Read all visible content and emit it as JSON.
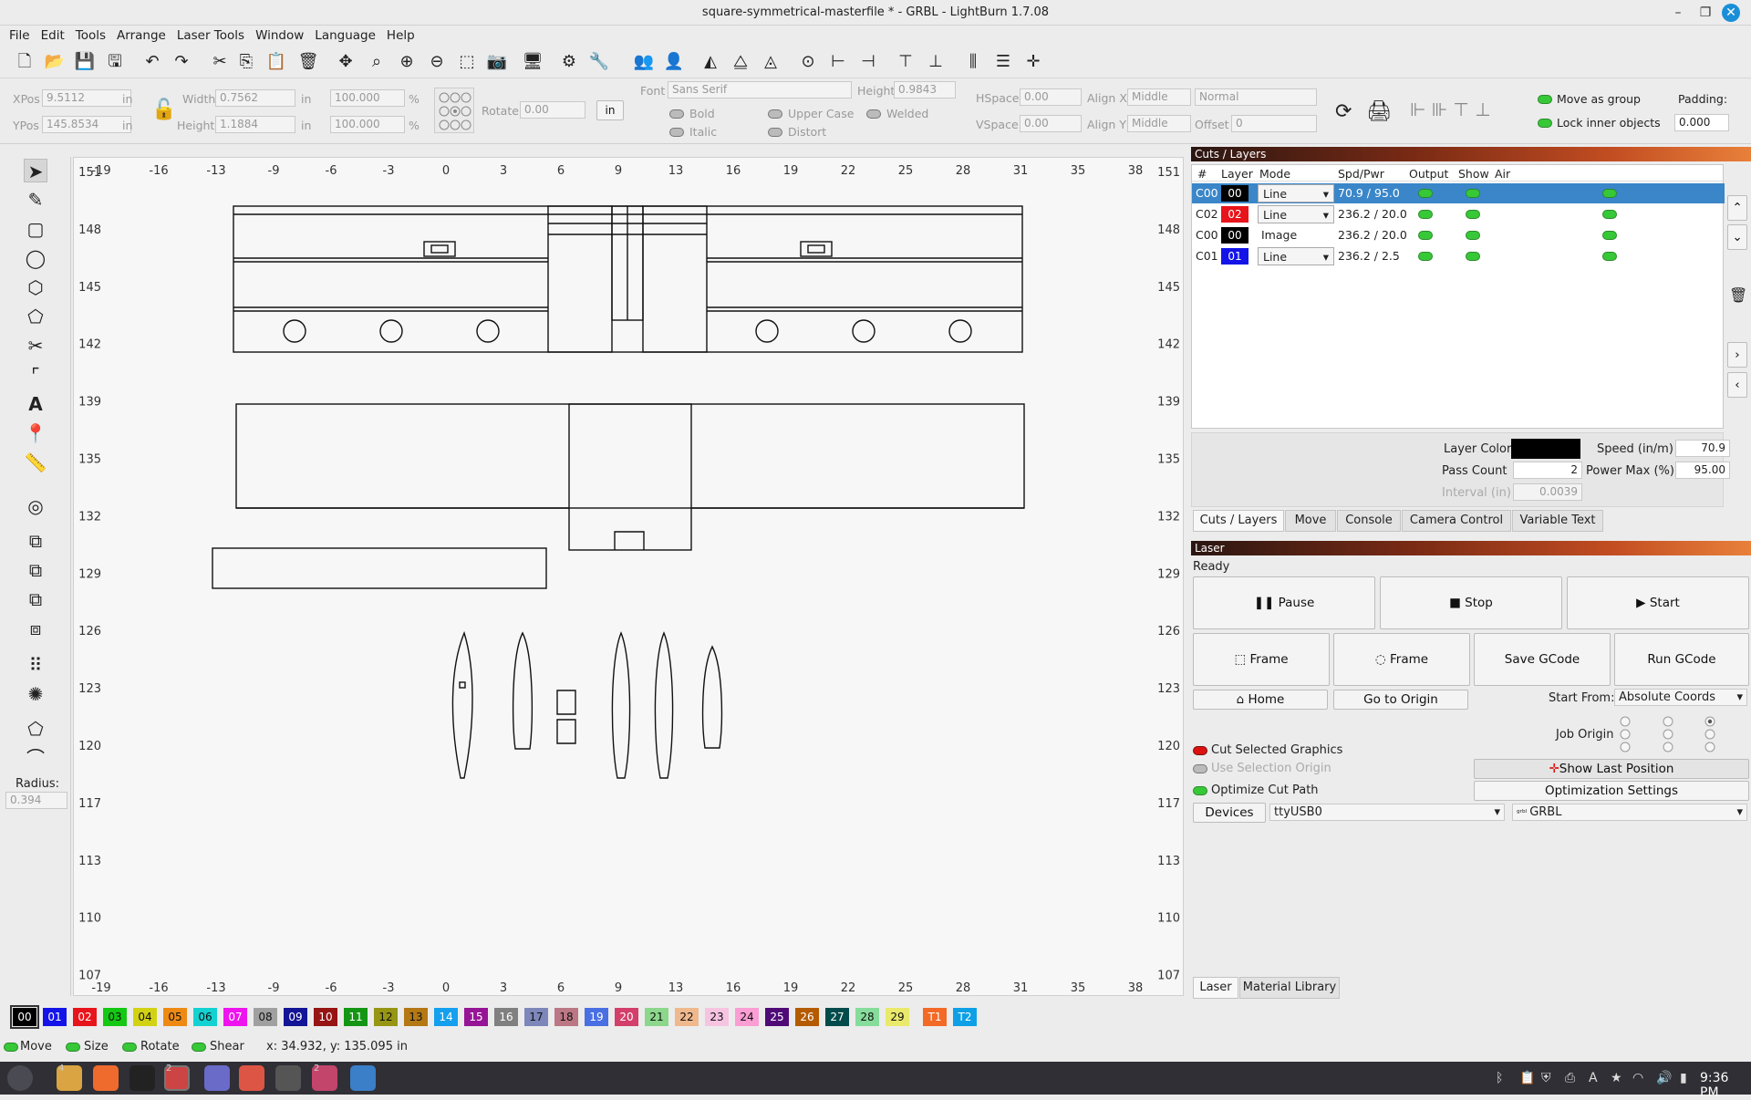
{
  "window": {
    "title": "square-symmetrical-masterfile * - GRBL - LightBurn 1.7.08"
  },
  "menu": [
    "File",
    "Edit",
    "Tools",
    "Arrange",
    "Laser Tools",
    "Window",
    "Language",
    "Help"
  ],
  "props": {
    "xpos_label": "XPos",
    "xpos": "9.5112",
    "ypos_label": "YPos",
    "ypos": "145.8534",
    "unit": "in",
    "width_label": "Width",
    "width": "0.7562",
    "height_label": "Height",
    "height": "1.1884",
    "scale_w": "100.000",
    "scale_h": "100.000",
    "percent": "%",
    "rotate_label": "Rotate",
    "rotate": "0.00",
    "in_btn": "in",
    "font_label": "Font",
    "font": "Sans Serif",
    "fheight_label": "Height",
    "fheight": "0.9843",
    "hspace_label": "HSpace",
    "hspace": "0.00",
    "vspace_label": "VSpace",
    "vspace": "0.00",
    "alignx_label": "Align X",
    "alignx": "Middle",
    "aligny_label": "Align Y",
    "aligny": "Middle",
    "normal": "Normal",
    "offset_label": "Offset",
    "offset": "0",
    "bold": "Bold",
    "italic": "Italic",
    "upper": "Upper Case",
    "distort": "Distort",
    "welded": "Welded",
    "move_group": "Move as group",
    "lock_inner": "Lock inner objects",
    "padding_label": "Padding:",
    "padding": "0.000"
  },
  "left_radius": {
    "label": "Radius:",
    "value": "0.394"
  },
  "axes": {
    "x": [
      "-19",
      "-16",
      "-13",
      "-9",
      "-6",
      "-3",
      "0",
      "3",
      "6",
      "9",
      "13",
      "16",
      "19",
      "22",
      "25",
      "28",
      "31",
      "35",
      "38"
    ],
    "y": [
      "151",
      "148",
      "145",
      "142",
      "139",
      "135",
      "132",
      "129",
      "126",
      "123",
      "120",
      "117",
      "113",
      "110",
      "107"
    ]
  },
  "cuts": {
    "title": "Cuts / Layers",
    "headers": [
      "#",
      "Layer",
      "Mode",
      "Spd/Pwr",
      "Output",
      "Show",
      "Air"
    ],
    "rows": [
      {
        "num": "C00",
        "layer": "00",
        "color": "#000000",
        "mode": "Line",
        "dropdown": true,
        "spdpwr": "70.9 / 95.0",
        "selected": true
      },
      {
        "num": "C02",
        "layer": "02",
        "color": "#e8141b",
        "mode": "Line",
        "dropdown": true,
        "spdpwr": "236.2 / 20.0",
        "selected": false
      },
      {
        "num": "C00",
        "layer": "00",
        "color": "#000000",
        "mode": "Image",
        "dropdown": false,
        "spdpwr": "236.2 / 20.0",
        "selected": false
      },
      {
        "num": "C01",
        "layer": "01",
        "color": "#1414e8",
        "mode": "Line",
        "dropdown": true,
        "spdpwr": "236.2 / 2.5",
        "selected": false
      }
    ],
    "layer_color_label": "Layer Color",
    "speed_label": "Speed (in/m)",
    "speed": "70.9",
    "pass_label": "Pass Count",
    "pass": "2",
    "power_label": "Power Max (%)",
    "power": "95.00",
    "interval_label": "Interval (in)",
    "interval": "0.0039"
  },
  "tabs1": [
    "Cuts / Layers",
    "Move",
    "Console",
    "Camera Control",
    "Variable Text"
  ],
  "laser": {
    "title": "Laser",
    "status": "Ready",
    "pause": "Pause",
    "stop": "Stop",
    "start": "Start",
    "frame1": "Frame",
    "frame2": "Frame",
    "save_gcode": "Save GCode",
    "run_gcode": "Run GCode",
    "home": "Home",
    "go_origin": "Go to Origin",
    "start_from_label": "Start From:",
    "start_from": "Absolute Coords",
    "job_origin": "Job Origin",
    "cut_selected": "Cut Selected Graphics",
    "use_sel_origin": "Use Selection Origin",
    "optimize": "Optimize Cut Path",
    "show_last": "Show Last Position",
    "opt_settings": "Optimization Settings",
    "devices": "Devices",
    "port": "ttyUSB0",
    "device": "GRBL"
  },
  "tabs2": [
    "Laser",
    "Material Library"
  ],
  "palette": [
    {
      "l": "00",
      "c": "#000000",
      "f": "#ffffff"
    },
    {
      "l": "01",
      "c": "#1414e8",
      "f": "#ffffff"
    },
    {
      "l": "02",
      "c": "#e8141b",
      "f": "#ffffff"
    },
    {
      "l": "03",
      "c": "#14c814",
      "f": "#111111"
    },
    {
      "l": "04",
      "c": "#d2d214",
      "f": "#111111"
    },
    {
      "l": "05",
      "c": "#ee8a14",
      "f": "#111111"
    },
    {
      "l": "06",
      "c": "#14d2d2",
      "f": "#111111"
    },
    {
      "l": "07",
      "c": "#ee14ee",
      "f": "#ffffff"
    },
    {
      "l": "08",
      "c": "#a0a0a0",
      "f": "#111111"
    },
    {
      "l": "09",
      "c": "#141496",
      "f": "#ffffff"
    },
    {
      "l": "10",
      "c": "#961414",
      "f": "#ffffff"
    },
    {
      "l": "11",
      "c": "#149614",
      "f": "#ffffff"
    },
    {
      "l": "12",
      "c": "#969614",
      "f": "#111111"
    },
    {
      "l": "13",
      "c": "#b47814",
      "f": "#111111"
    },
    {
      "l": "14",
      "c": "#14a0ee",
      "f": "#ffffff"
    },
    {
      "l": "15",
      "c": "#961496",
      "f": "#ffffff"
    },
    {
      "l": "16",
      "c": "#808080",
      "f": "#ffffff"
    },
    {
      "l": "17",
      "c": "#7d87b9",
      "f": "#111111"
    },
    {
      "l": "18",
      "c": "#bb7784",
      "f": "#111111"
    },
    {
      "l": "19",
      "c": "#4a6fe3",
      "f": "#ffffff"
    },
    {
      "l": "20",
      "c": "#d33f6a",
      "f": "#ffffff"
    },
    {
      "l": "21",
      "c": "#8cd78c",
      "f": "#111111"
    },
    {
      "l": "22",
      "c": "#f0b98d",
      "f": "#111111"
    },
    {
      "l": "23",
      "c": "#f6c4e1",
      "f": "#111111"
    },
    {
      "l": "24",
      "c": "#fa9ed4",
      "f": "#111111"
    },
    {
      "l": "25",
      "c": "#500a78",
      "f": "#ffffff"
    },
    {
      "l": "26",
      "c": "#b45a00",
      "f": "#ffffff"
    },
    {
      "l": "27",
      "c": "#004b4b",
      "f": "#ffffff"
    },
    {
      "l": "28",
      "c": "#86dc9a",
      "f": "#111111"
    },
    {
      "l": "29",
      "c": "#e9e96b",
      "f": "#111111"
    },
    {
      "l": "T1",
      "c": "#f36926",
      "f": "#ffffff"
    },
    {
      "l": "T2",
      "c": "#0ea0e6",
      "f": "#ffffff"
    }
  ],
  "status": {
    "move": "Move",
    "size": "Size",
    "rotate": "Rotate",
    "shear": "Shear",
    "coords": "x: 34.932, y: 135.095 in"
  },
  "taskbar": {
    "clock": "9:36 PM",
    "badge1": "4",
    "badge2": "2",
    "badge3": "2"
  }
}
